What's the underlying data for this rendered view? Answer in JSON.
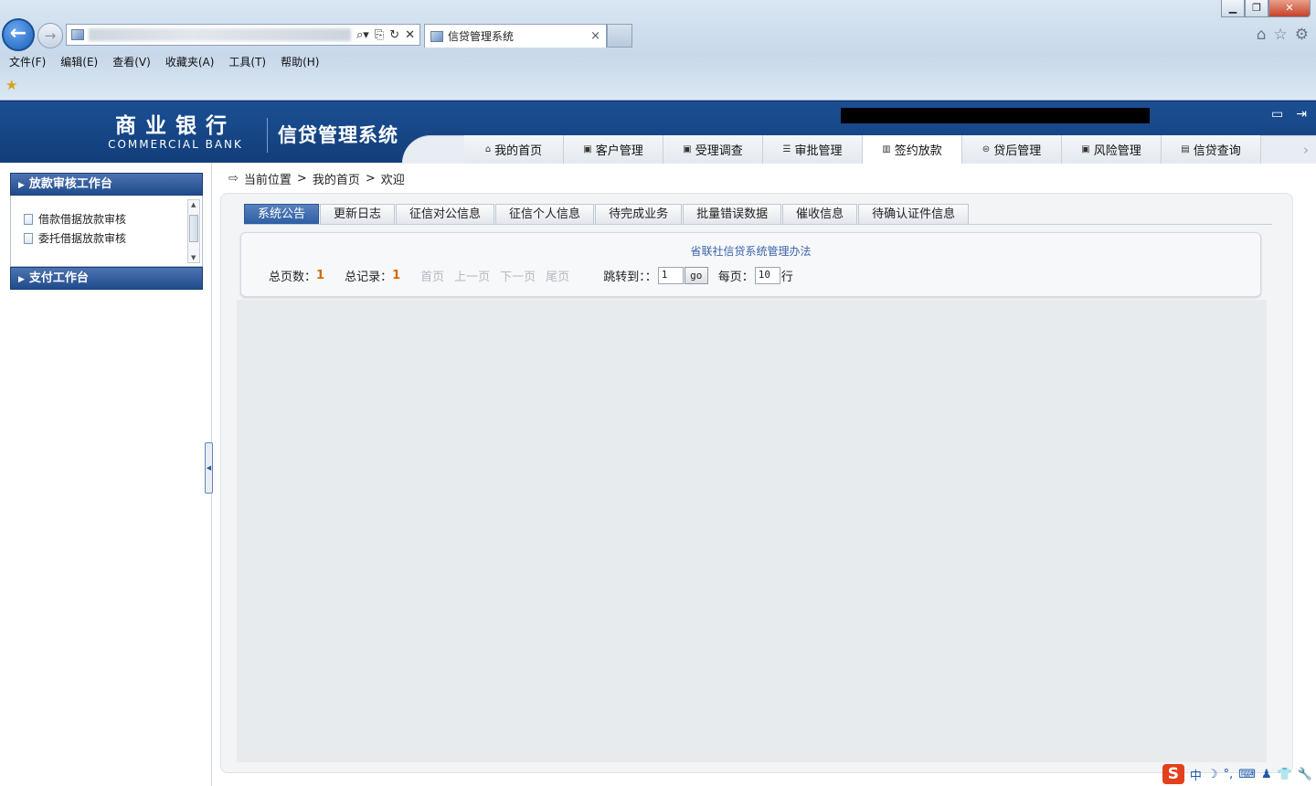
{
  "browser": {
    "tab_title": "信贷管理系统",
    "tab_close": "×",
    "back_glyph": "←",
    "forward_glyph": "→",
    "addr_tools": [
      "⌕▾",
      "⎘",
      "↻",
      "✕"
    ],
    "right_tools": [
      "⌂",
      "☆",
      "⚙"
    ],
    "window_controls": {
      "minimize": "▁",
      "maximize": "❐",
      "close": "✕"
    },
    "menu": [
      "文件(F)",
      "编辑(E)",
      "查看(V)",
      "收藏夹(A)",
      "工具(T)",
      "帮助(H)"
    ],
    "favorites_icon": "★"
  },
  "header": {
    "bank_name": "商业银行",
    "bank_name_en": "COMMERCIAL BANK",
    "system_name": "信贷管理系统",
    "icons": [
      "monitor-icon",
      "logout-icon"
    ],
    "icon_glyphs": [
      "▭",
      "⇥"
    ],
    "nav": [
      {
        "label": "我的首页",
        "icon": "⌂",
        "active": false
      },
      {
        "label": "客户管理",
        "icon": "▣",
        "active": false
      },
      {
        "label": "受理调查",
        "icon": "▣",
        "active": false
      },
      {
        "label": "审批管理",
        "icon": "☰",
        "active": false
      },
      {
        "label": "签约放款",
        "icon": "▥",
        "active": true
      },
      {
        "label": "贷后管理",
        "icon": "⊜",
        "active": false
      },
      {
        "label": "风险管理",
        "icon": "▣",
        "active": false
      },
      {
        "label": "信贷查询",
        "icon": "▤",
        "active": false
      }
    ],
    "nav_scroll": "›"
  },
  "sidebar": {
    "section1": {
      "title": "放款审核工作台",
      "arrow": "▶"
    },
    "links": [
      "借款借据放款审核",
      "委托借据放款审核"
    ],
    "section2": {
      "title": "支付工作台",
      "arrow": "▶"
    },
    "scroll_up": "▲",
    "scroll_down": "▼",
    "collapse_glyph": "◀"
  },
  "breadcrumb": {
    "icon": "⇨",
    "items": [
      "当前位置",
      ">",
      "我的首页",
      ">",
      "欢迎"
    ]
  },
  "content": {
    "tabs": [
      {
        "label": "系统公告",
        "active": true
      },
      {
        "label": "更新日志",
        "active": false
      },
      {
        "label": "征信对公信息",
        "active": false
      },
      {
        "label": "征信个人信息",
        "active": false
      },
      {
        "label": "待完成业务",
        "active": false
      },
      {
        "label": "批量错误数据",
        "active": false
      },
      {
        "label": "催收信息",
        "active": false
      },
      {
        "label": "待确认证件信息",
        "active": false
      }
    ],
    "notice_link": "省联社信贷系统管理办法",
    "pager": {
      "total_pages_label": "总页数：",
      "total_pages": "1",
      "total_records_label": "总记录：",
      "total_records": "1",
      "first": "首页",
      "prev": "上一页",
      "next": "下一页",
      "last": "尾页",
      "jump_label": "跳转到：：",
      "jump_value": "1",
      "go": "go",
      "per_page_label": "每页：",
      "per_page_value": "10",
      "per_page_unit": "行"
    }
  },
  "tray": {
    "ime_logo": "S",
    "items": [
      "中",
      "☽",
      "°,",
      "⌨",
      "♟",
      "👕",
      "🔧"
    ]
  },
  "colors": {
    "header_blue": "#1b4f93",
    "active_tab": "#2d5ea4",
    "count_orange": "#d46a00",
    "link_blue": "#3b64a8"
  }
}
